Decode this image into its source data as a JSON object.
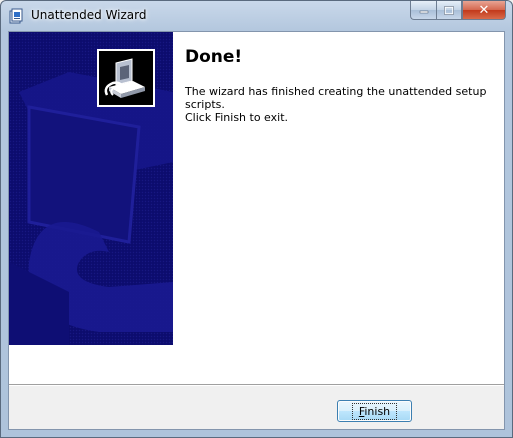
{
  "window": {
    "title": "Unattended Wizard",
    "icon": "wizard-app-icon"
  },
  "caption_buttons": {
    "minimize_icon": "minimize-icon",
    "maximize_icon": "maximize-icon",
    "close_icon": "close-icon",
    "close_glyph": "✕"
  },
  "page": {
    "heading": "Done!",
    "message": "The wizard has finished creating the unattended setup scripts.",
    "instruction": "Click Finish to exit."
  },
  "buttons": {
    "finish_accel": "F",
    "finish_rest": "inish"
  },
  "colors": {
    "side_panel": "#0c0c6e",
    "side_panel_shape": "#1a1a8c",
    "title_bar": "#b3c7de",
    "close_button": "#c2391b"
  }
}
